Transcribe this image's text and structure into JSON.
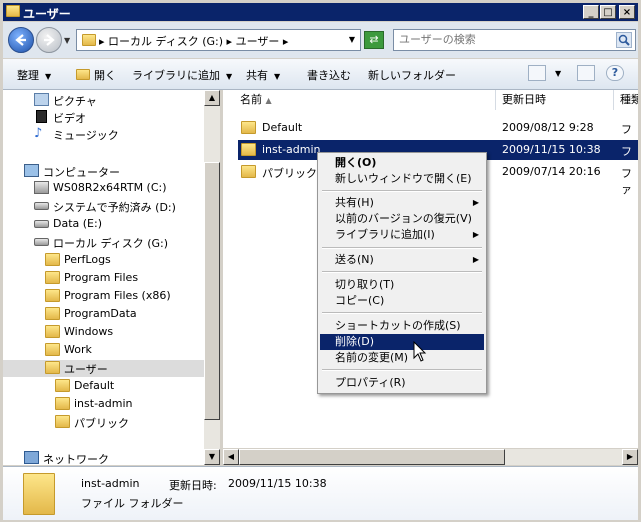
{
  "window": {
    "title": "ユーザー",
    "min": "_",
    "max": "□",
    "close": "×"
  },
  "address": {
    "crumbs": [
      "▸ ローカル ディスク (G:) ▸ ユーザー ▸"
    ],
    "search_placeholder": "ユーザーの検索"
  },
  "commands": {
    "organize": "整理",
    "open": "開く",
    "include_library": "ライブラリに追加",
    "share": "共有",
    "burn": "書き込む",
    "new_folder": "新しいフォルダー"
  },
  "nav": {
    "items": [
      "ピクチャ",
      "ビデオ",
      "ミュージック",
      "コンピューター",
      "WS08R2x64RTM (C:)",
      "システムで予約済み (D:)",
      "Data (E:)",
      "ローカル ディスク (G:)",
      "PerfLogs",
      "Program Files",
      "Program Files (x86)",
      "ProgramData",
      "Windows",
      "Work",
      "ユーザー",
      "Default",
      "inst-admin",
      "パブリック",
      "ネットワーク"
    ]
  },
  "columns": {
    "name": "名前",
    "modified": "更新日時",
    "type": "種類"
  },
  "files": [
    {
      "name": "Default",
      "date": "2009/08/12 9:28",
      "type": "ファ"
    },
    {
      "name": "inst-admin",
      "date": "2009/11/15 10:38",
      "type": "ファ"
    },
    {
      "name": "パブリック",
      "date": "2009/07/14 20:16",
      "type": "ファ"
    }
  ],
  "context_menu": {
    "open": "開く(O)",
    "open_new_window": "新しいウィンドウで開く(E)",
    "share": "共有(H)",
    "restore": "以前のバージョンの復元(V)",
    "include_library": "ライブラリに追加(I)",
    "send_to": "送る(N)",
    "cut": "切り取り(T)",
    "copy": "コピー(C)",
    "shortcut": "ショートカットの作成(S)",
    "delete": "削除(D)",
    "rename": "名前の変更(M)",
    "properties": "プロパティ(R)"
  },
  "details": {
    "name": "inst-admin",
    "type": "ファイル フォルダー",
    "modified_label": "更新日時:",
    "modified_value": "2009/11/15 10:38"
  },
  "colors": {
    "title": "#0a246a",
    "selection": "#0a246a",
    "folder": "#e3b84a"
  }
}
